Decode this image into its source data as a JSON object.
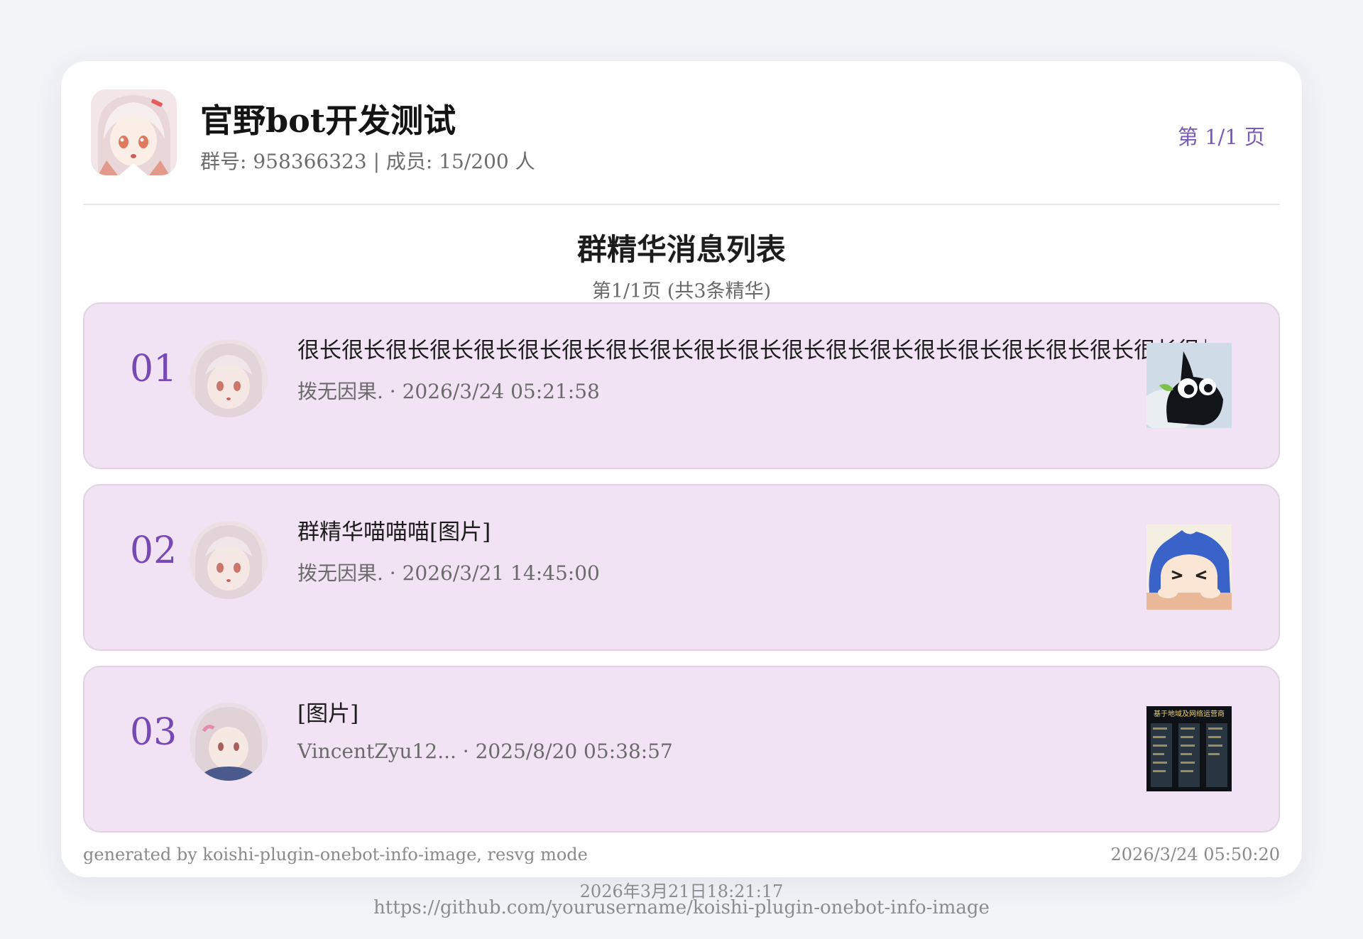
{
  "header": {
    "group_name": "官野bot开发测试",
    "group_meta": "群号: 958366323 | 成员: 15/200 人",
    "page_indicator": "第 1/1 页"
  },
  "section": {
    "title": "群精华消息列表",
    "subtitle": "第1/1页 (共3条精华)"
  },
  "items": [
    {
      "num": "01",
      "text": "很长很长很长很长很长很长很长很长很长很长很长很长很长很长很长很长很长很长很长很长很长很长很长很长",
      "meta": "拨无因果. · 2026/3/24 05:21:58",
      "thumb_icon": "black-cat-sticker-icon"
    },
    {
      "num": "02",
      "text": "群精华喵喵喵[图片]",
      "meta": "拨无因果. · 2026/3/21 14:45:00",
      "thumb_icon": "blue-hair-anime-sticker-icon"
    },
    {
      "num": "03",
      "text": "[图片]",
      "meta": "VincentZyu12... · 2025/8/20 05:38:57",
      "thumb_icon": "dark-table-screenshot-icon",
      "thumb_caption": "基于地域及网络运营商"
    }
  ],
  "footer": {
    "generated": "generated by koishi-plugin-onebot-info-image, resvg mode",
    "timestamp": "2026/3/24 05:50:20"
  },
  "outer": {
    "date": "2026年3月21日18:21:17",
    "url": "https://github.com/yourusername/koishi-plugin-onebot-info-image"
  },
  "colors": {
    "accent": "#7649b5",
    "item_bg": "#f1e3f3",
    "page_bg": "#f1f3f7"
  }
}
